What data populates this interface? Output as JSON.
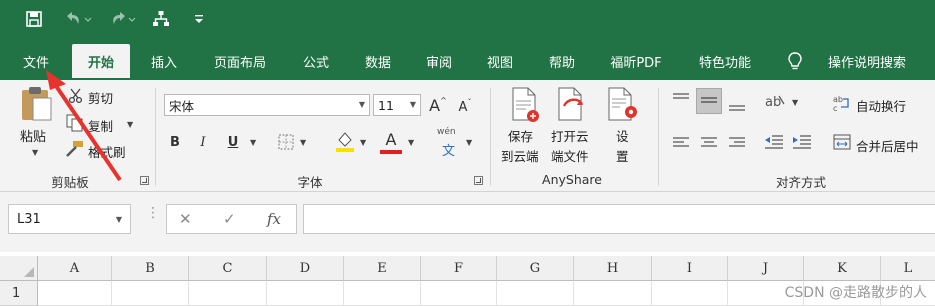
{
  "tabs": [
    "文件",
    "开始",
    "插入",
    "页面布局",
    "公式",
    "数据",
    "审阅",
    "视图",
    "帮助",
    "福昕PDF",
    "特色功能",
    "操作说明搜索"
  ],
  "active_tab_index": 1,
  "clipboard": {
    "paste": "粘贴",
    "cut": "剪切",
    "copy": "复制",
    "format_painter": "格式刷",
    "label": "剪贴板"
  },
  "font": {
    "family": "宋体",
    "size": "11",
    "grow": "A",
    "shrink": "A",
    "bold": "B",
    "italic": "I",
    "underline": "U",
    "font_color": "A",
    "phonetic_top": "wén",
    "phonetic_bottom": "文",
    "label": "字体"
  },
  "anyshare": {
    "save_line1": "保存",
    "save_line2": "到云端",
    "open_line1": "打开云",
    "open_line2": "端文件",
    "settings_line1": "设",
    "settings_line2": "置",
    "label": "AnyShare"
  },
  "alignment": {
    "wrap_text": "自动换行",
    "merge_center": "合并后居中",
    "label": "对齐方式"
  },
  "formula_bar": {
    "name_box": "L31",
    "cancel": "✕",
    "enter": "✓",
    "fx": "fx"
  },
  "columns": [
    "A",
    "B",
    "C",
    "D",
    "E",
    "F",
    "G",
    "H",
    "I",
    "J",
    "K",
    "L"
  ],
  "rows": [
    "1"
  ],
  "watermark": "CSDN @走路散步的人",
  "colors": {
    "ribbon_green": "#217346",
    "annotation_arrow": "#e8322d"
  }
}
